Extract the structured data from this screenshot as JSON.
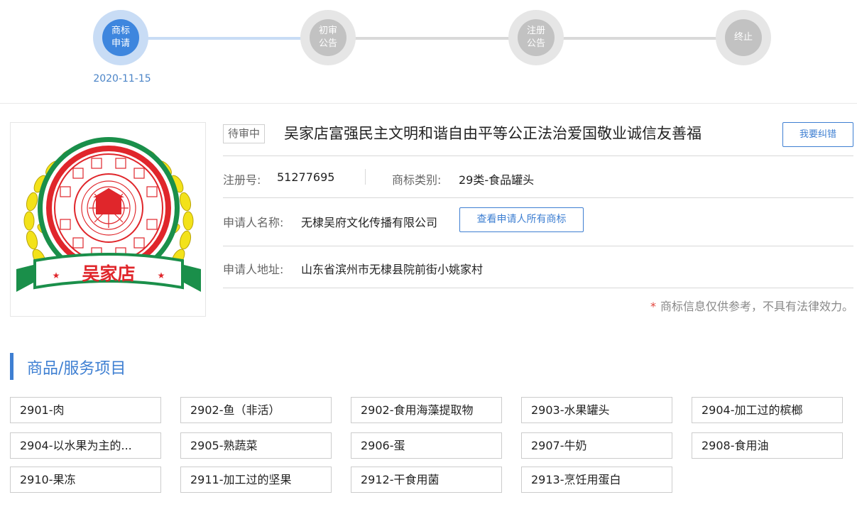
{
  "progress": {
    "steps": [
      {
        "label": "商标\n申请",
        "active": true
      },
      {
        "label": "初审\n公告",
        "active": false
      },
      {
        "label": "注册\n公告",
        "active": false
      },
      {
        "label": "终止",
        "active": false
      }
    ],
    "active_date": "2020-11-15"
  },
  "logo": {
    "text": "吴家店",
    "seal_text": "富强民主文明和谐自由平等公正法治爱国敬业诚信友善福"
  },
  "trademark": {
    "status": "待审中",
    "name": "吴家店富强民主文明和谐自由平等公正法治爱国敬业诚信友善福",
    "report_button": "我要纠错",
    "reg_no_label": "注册号:",
    "reg_no": "51277695",
    "class_label": "商标类别:",
    "class_value": "29类-食品罐头",
    "applicant_label": "申请人名称:",
    "applicant": "无棣吴府文化传播有限公司",
    "view_all_button": "查看申请人所有商标",
    "address_label": "申请人地址:",
    "address": "山东省滨州市无棣县院前街小姚家村",
    "disclaimer_star": "*",
    "disclaimer": "商标信息仅供参考，不具有法律效力。"
  },
  "goods_section": {
    "title": "商品/服务项目",
    "items": [
      "2901-肉",
      "2902-鱼（非活）",
      "2902-食用海藻提取物",
      "2903-水果罐头",
      "2904-加工过的槟榔",
      "2904-以水果为主的...",
      "2905-熟蔬菜",
      "2906-蛋",
      "2907-牛奶",
      "2908-食用油",
      "2910-果冻",
      "2911-加工过的坚果",
      "2912-干食用菌",
      "2913-烹饪用蛋白"
    ]
  },
  "colors": {
    "accent": "#3e7fd2",
    "step_active": "#3e86de",
    "step_inactive": "#c2c2c2",
    "logo_red": "#e0262b",
    "logo_green": "#1a8f4a",
    "logo_yellow": "#f3e21a"
  }
}
